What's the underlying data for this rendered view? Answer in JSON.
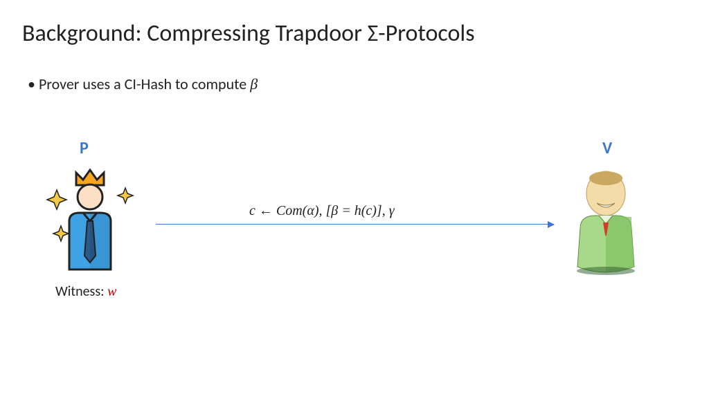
{
  "title": "Background: Compressing Trapdoor Σ-Protocols",
  "bullet_prefix": "Prover uses a CI-Hash to compute ",
  "bullet_symbol": "β",
  "prover_label": "P",
  "verifier_label": "V",
  "witness_label": "Witness: ",
  "witness_symbol": "w",
  "arrow_formula": "c ← Com(α), [β = h(c)], γ"
}
